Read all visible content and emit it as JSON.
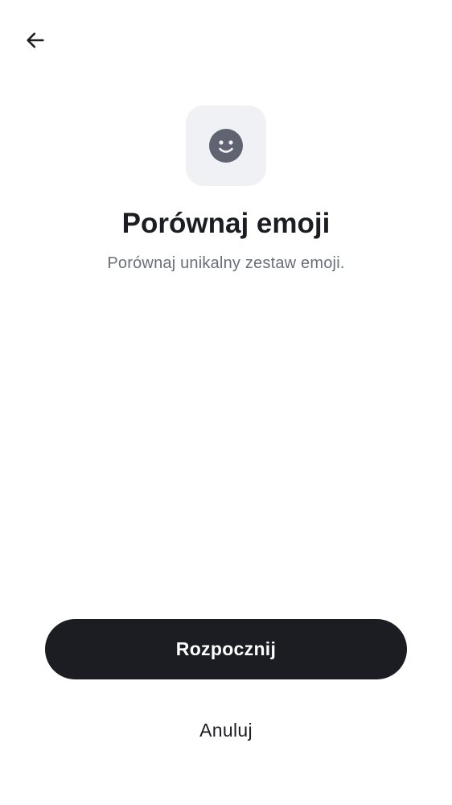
{
  "header": {
    "back_icon": "arrow-left-icon"
  },
  "hero": {
    "icon": "smiley-face-icon",
    "icon_color": "#5f6470",
    "tile_color": "#f0f1f5",
    "title": "Porównaj emoji",
    "subtitle": "Porównaj unikalny zestaw emoji."
  },
  "actions": {
    "start_label": "Rozpocznij",
    "cancel_label": "Anuluj",
    "primary_color": "#1c1d22"
  }
}
